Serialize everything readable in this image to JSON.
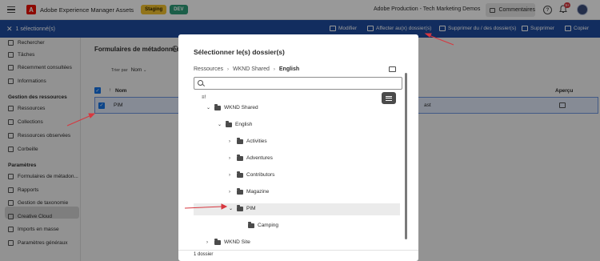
{
  "topbar": {
    "app_title": "Adobe Experience Manager Assets",
    "env_staging": "Staging",
    "env_dev": "DEV",
    "org": "Adobe Production - Tech Marketing Demos",
    "comments_label": "Commentaires",
    "notifications_count": "9+"
  },
  "selection_bar": {
    "count": "1 sélectionné(s)",
    "actions": [
      "Modifier",
      "Affecter au(x) dossier(s)",
      "Supprimer du / des dossier(s)",
      "Supprimer",
      "Copier"
    ]
  },
  "sidebar": {
    "items_top": [
      "Rechercher",
      "Tâches",
      "Récemment consultées",
      "Informations"
    ],
    "heading_resources": "Gestion des ressources",
    "items_resources": [
      "Ressources",
      "Collections",
      "Ressources observées",
      "Corbeille"
    ],
    "heading_params": "Paramètres",
    "items_params": [
      "Formulaires de métadon...",
      "Rapports",
      "Gestion de taxonomie",
      "Creative Cloud",
      "Imports en masse",
      "Paramètres généraux"
    ]
  },
  "main": {
    "title": "Formulaires de métadonnées",
    "sort_prefix": "Trier par",
    "sort_value": "Nom",
    "col_name": "Nom",
    "col_preview": "Aperçu",
    "row_name": "PIM",
    "row_truncated": "ast"
  },
  "dialog": {
    "title": "Sélectionner le(s) dossier(s)",
    "breadcrumbs": [
      "Ressources",
      "WKND Shared",
      "English"
    ],
    "search_placeholder": "",
    "tree": {
      "wknd_shared": "WKND Shared",
      "english": "English",
      "activities": "Activities",
      "adventures": "Adventures",
      "contributors": "Contributors",
      "magazine": "Magazine",
      "pim": "PIM",
      "camping": "Camping",
      "wknd_site": "WKND Site"
    },
    "footer": "1 dossier"
  },
  "colors": {
    "selection_bar": "#1e4b9e",
    "annotation_red": "#d7373f",
    "accent_blue": "#1473e6"
  }
}
